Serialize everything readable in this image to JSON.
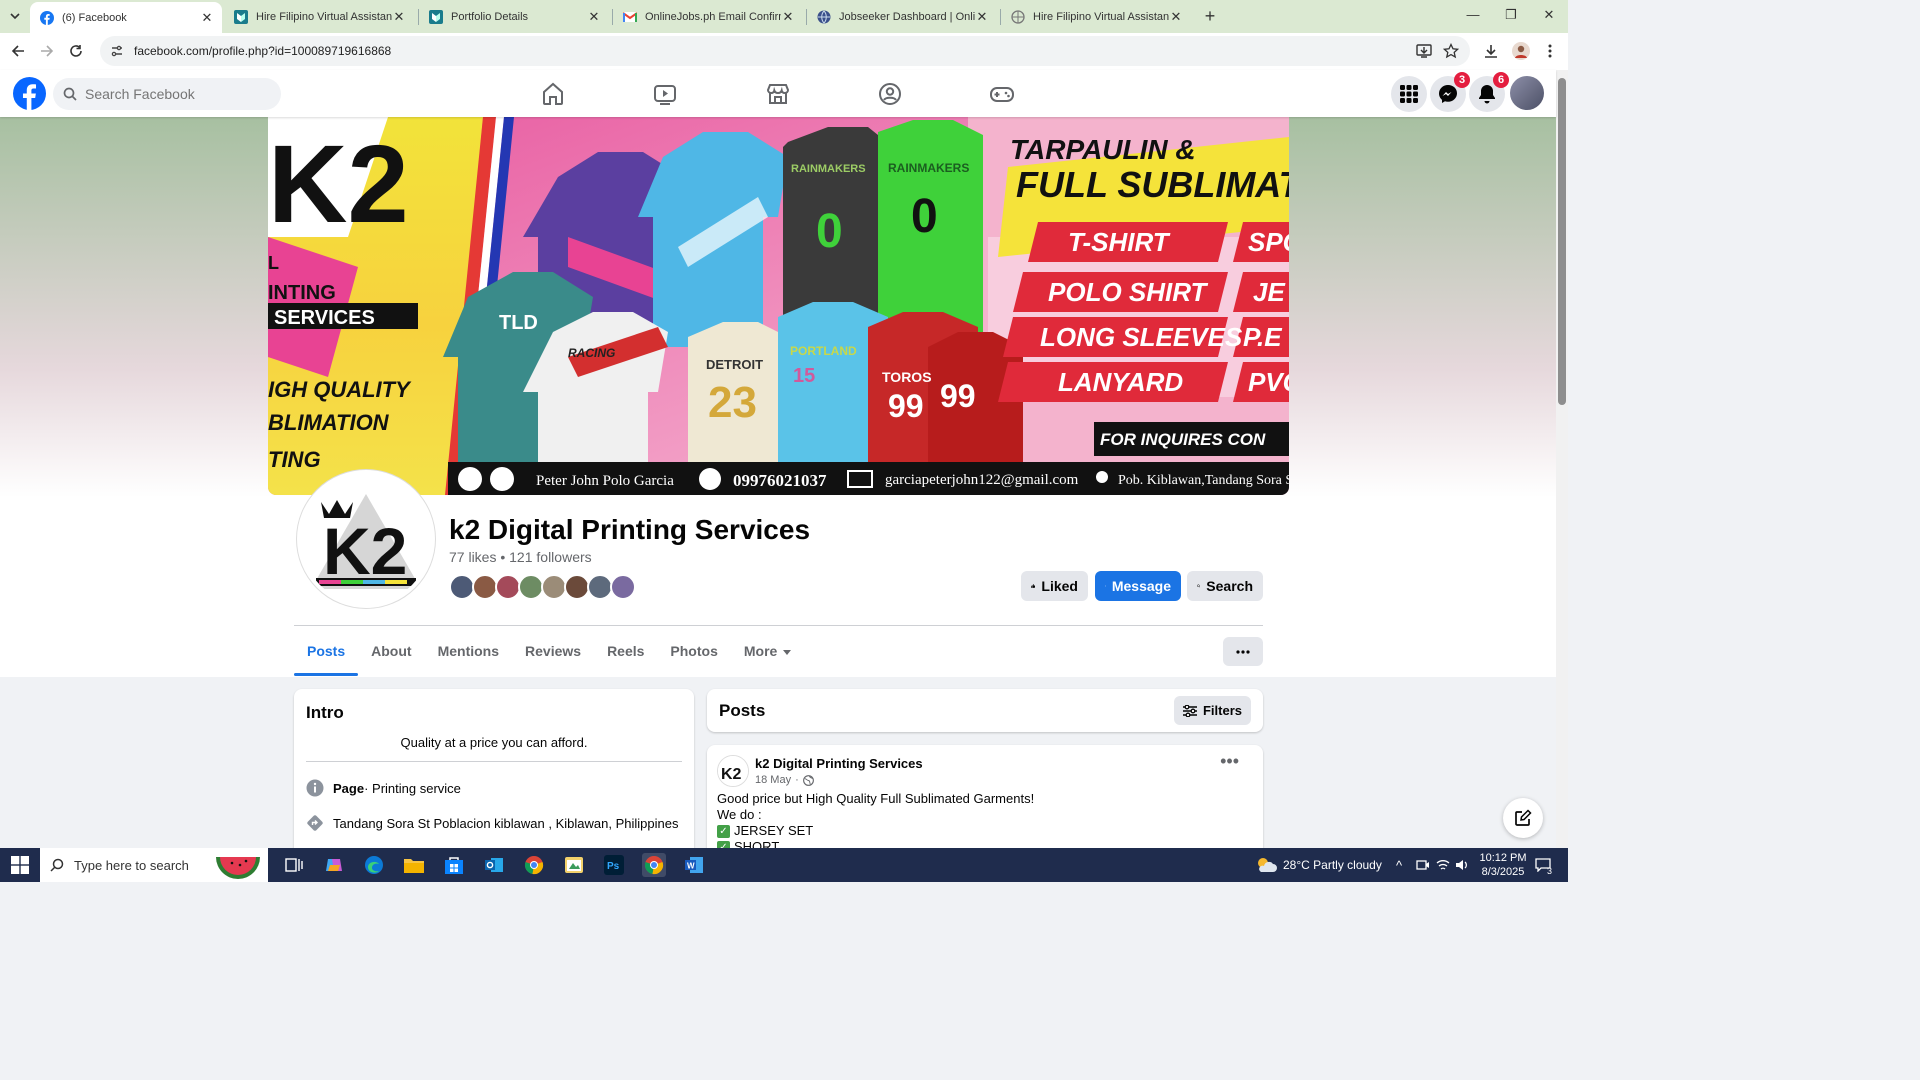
{
  "browser": {
    "tabs": [
      {
        "title": "(6) Facebook",
        "favicon": "facebook-icon",
        "active": true
      },
      {
        "title": "Hire Filipino Virtual Assistants |",
        "favicon": "onlinejobs-icon"
      },
      {
        "title": "Portfolio Details",
        "favicon": "onlinejobs-icon"
      },
      {
        "title": "OnlineJobs.ph Email Confirmati",
        "favicon": "gmail-icon"
      },
      {
        "title": "Jobseeker Dashboard | OnlineJo",
        "favicon": "globe-icon"
      },
      {
        "title": "Hire Filipino Virtual Assistants |",
        "favicon": "onlinejobs-icon"
      }
    ],
    "url": "facebook.com/profile.php?id=100089719616868"
  },
  "fb_header": {
    "search_placeholder": "Search Facebook",
    "messenger_badge": "3",
    "notifications_badge": "6"
  },
  "cover": {
    "logo_text": "K2",
    "left_lines": [
      "L",
      "INTING",
      "SERVICES",
      "IGH QUALITY",
      "BLIMATION",
      "TING"
    ],
    "headline_1": "TARPAULIN &",
    "headline_2": "FULL SUBLIMATIO",
    "services_left": [
      "T-SHIRT",
      "POLO SHIRT",
      "LONG SLEEVES",
      "LANYARD"
    ],
    "services_right": [
      "SPORT",
      "JE",
      "P.E UN",
      "PVC"
    ],
    "inquire": "FOR INQUIRES CON",
    "jersey_texts": [
      "TLD",
      "RACING",
      "DETROIT",
      "23",
      "PORTLAND",
      "15",
      "RAINMAKERS",
      "0",
      "RAINMAKERS",
      "0",
      "TOROS",
      "99",
      "99"
    ],
    "contact_name": "Peter John Polo Garcia",
    "contact_phone": "09976021037",
    "contact_email": "garciapeterjohn122@gmail.com",
    "contact_address": "Pob. Kiblawan,Tandang Sora St."
  },
  "page": {
    "name": "k2 Digital Printing Services",
    "stats": "77 likes • 121 followers",
    "liked_label": "Liked",
    "message_label": "Message",
    "search_label": "Search"
  },
  "page_tabs": [
    "Posts",
    "About",
    "Mentions",
    "Reviews",
    "Reels",
    "Photos",
    "More"
  ],
  "intro": {
    "title": "Intro",
    "bio": "Quality at a price you can afford.",
    "category_bold": "Page",
    "category": " · Printing service",
    "address": "Tandang Sora St Poblacion kiblawan , Kiblawan, Philippines"
  },
  "posts_section": {
    "title": "Posts",
    "filters_label": "Filters"
  },
  "post": {
    "author": "k2 Digital Printing Services",
    "date": "18 May",
    "line1": "Good price but High Quality Full Sublimated Garments!",
    "line2": "We do :",
    "item1": "JERSEY SET",
    "item2": "SHORT"
  },
  "taskbar": {
    "search_placeholder": "Type here to search",
    "weather": "28°C  Partly cloudy",
    "time": "10:12 PM",
    "date": "8/3/2025",
    "notif_count": "3"
  }
}
